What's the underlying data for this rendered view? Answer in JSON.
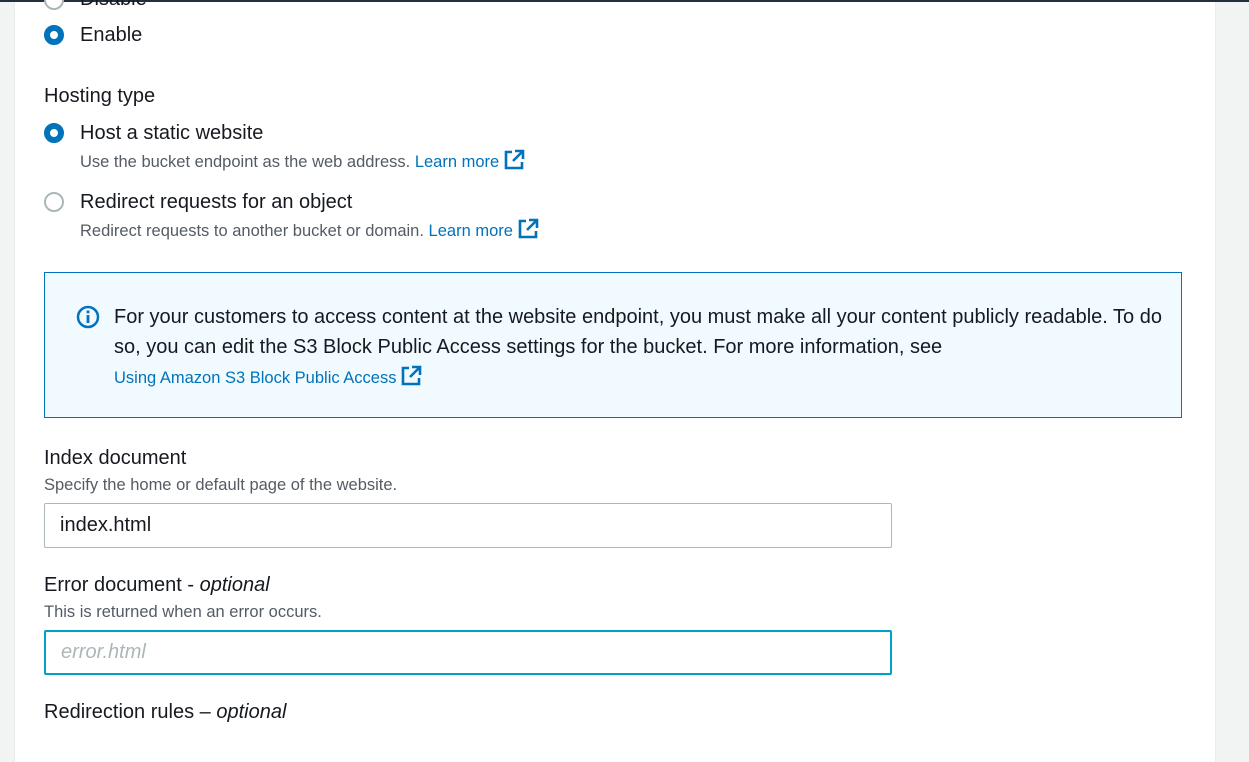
{
  "static_website": {
    "disable_label": "Disable",
    "enable_label": "Enable",
    "selected": "enable"
  },
  "hosting_type": {
    "label": "Hosting type",
    "options": [
      {
        "label": "Host a static website",
        "description": "Use the bucket endpoint as the web address.",
        "link": "Learn more",
        "selected": true
      },
      {
        "label": "Redirect requests for an object",
        "description": "Redirect requests to another bucket or domain.",
        "link": "Learn more",
        "selected": false
      }
    ]
  },
  "info_alert": {
    "icon": "info-icon",
    "text": "For your customers to access content at the website endpoint, you must make all your content publicly readable. To do so, you can edit the S3 Block Public Access settings for the bucket. For more information, see",
    "link": "Using Amazon S3 Block Public Access"
  },
  "index_document": {
    "label": "Index document",
    "description": "Specify the home or default page of the website.",
    "value": "index.html"
  },
  "error_document": {
    "label": "Error document",
    "optional_prefix": " - ",
    "optional": "optional",
    "description": "This is returned when an error occurs.",
    "value": "",
    "placeholder": "error.html"
  },
  "redirection_rules": {
    "label": "Redirection rules",
    "optional_prefix": " – ",
    "optional": "optional"
  },
  "colors": {
    "accent": "#0073bb",
    "focus": "#00a1c9",
    "info_bg": "#f1faff"
  }
}
